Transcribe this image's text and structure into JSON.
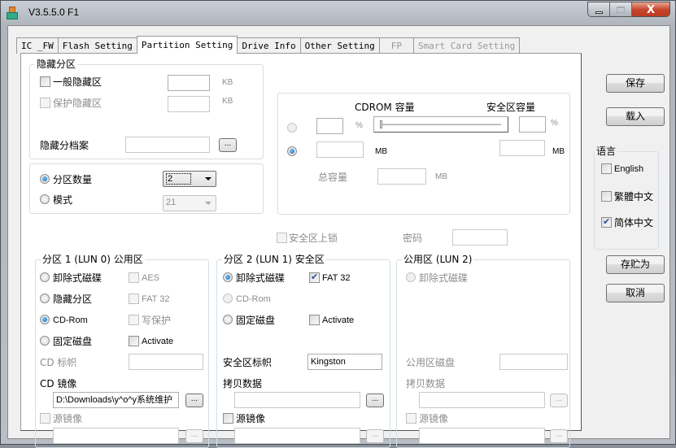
{
  "window": {
    "title": "V3.5.5.0 F1",
    "controls": {
      "minimize": "minimize",
      "maximize": "maximize",
      "close": "X"
    }
  },
  "tabs": [
    {
      "label": "IC _FW",
      "state": "normal"
    },
    {
      "label": "Flash Setting",
      "state": "normal"
    },
    {
      "label": "Partition Setting",
      "state": "active"
    },
    {
      "label": "Drive Info",
      "state": "normal"
    },
    {
      "label": "Other Setting",
      "state": "normal"
    },
    {
      "label": "FP",
      "state": "disabled"
    },
    {
      "label": "Smart Card Setting",
      "state": "disabled"
    }
  ],
  "hidden_partition": {
    "legend": "隐藏分区",
    "general_hidden": {
      "label": "一般隐藏区",
      "checked": false,
      "value": "",
      "unit": "KB"
    },
    "protected_hidden": {
      "label": "保护隐藏区",
      "checked": false,
      "value": "",
      "unit": "KB"
    },
    "hidden_file": {
      "label": "隐藏分档案",
      "value": "",
      "browse": "..."
    }
  },
  "partition_mode": {
    "count": {
      "label": "分区数量",
      "selected": true,
      "value": "2"
    },
    "mode": {
      "label": "模式",
      "selected": false,
      "value": "21"
    }
  },
  "capacity": {
    "cdrom_label": "CDROM 容量",
    "secure_label": "安全区容量",
    "percent_unit": "%",
    "mb_unit": "MB",
    "percent_mode_selected": false,
    "mb_mode_selected": true,
    "cdrom_percent": "",
    "secure_percent": "",
    "cdrom_mb": "",
    "secure_mb": "",
    "slider_value_pct": 0,
    "total_label": "总容量",
    "total_value": "",
    "total_unit": "MB"
  },
  "lock": {
    "label": "安全区上锁",
    "checked": false,
    "password_label": "密码",
    "password_value": ""
  },
  "lun0": {
    "legend": "分区 1 (LUN 0) 公用区",
    "options": [
      {
        "label": "卸除式磁碟",
        "selected": false
      },
      {
        "label": "隐藏分区",
        "selected": false
      },
      {
        "label": "CD-Rom",
        "selected": true
      },
      {
        "label": "固定磁盘",
        "selected": false
      }
    ],
    "checks": [
      {
        "label": "AES",
        "checked": false,
        "enabled": false
      },
      {
        "label": "FAT 32",
        "checked": false,
        "enabled": false
      },
      {
        "label": "写保护",
        "checked": false,
        "enabled": false
      },
      {
        "label": "Activate",
        "checked": false,
        "enabled": true
      }
    ],
    "cd_label": {
      "label": "CD 标帜",
      "value": ""
    },
    "cd_image": {
      "label": "CD 镜像",
      "value": "D:\\Downloads\\y^o^y系统维护",
      "browse": "..."
    },
    "source_image": {
      "label": "源镜像",
      "checked": false,
      "value": "",
      "browse": "..."
    }
  },
  "lun1": {
    "legend": "分区 2 (LUN 1) 安全区",
    "options": [
      {
        "label": "卸除式磁碟",
        "selected": true
      },
      {
        "label": "CD-Rom",
        "selected": false
      },
      {
        "label": "固定磁盘",
        "selected": false
      }
    ],
    "checks": [
      {
        "label": "FAT 32",
        "checked": true
      },
      {
        "label": "Activate",
        "checked": false
      }
    ],
    "secure_label": {
      "label": "安全区标帜",
      "value": "Kingston"
    },
    "copy_data": {
      "label": "拷贝数据",
      "value": "",
      "browse": "..."
    },
    "source_image": {
      "label": "源镜像",
      "checked": false,
      "value": "",
      "browse": "..."
    }
  },
  "lun2": {
    "legend": "公用区 (LUN 2)",
    "options": [
      {
        "label": "卸除式磁碟",
        "selected": false
      }
    ],
    "public_disk": {
      "label": "公用区磁盘",
      "value": ""
    },
    "copy_data": {
      "label": "拷贝数据",
      "value": "",
      "browse": "..."
    },
    "source_image": {
      "label": "源镜像",
      "checked": false,
      "value": "",
      "browse": "..."
    }
  },
  "side": {
    "save": "保存",
    "load": "载入",
    "language_legend": "语言",
    "languages": [
      {
        "label": "English",
        "checked": false
      },
      {
        "label": "繁體中文",
        "checked": false
      },
      {
        "label": "简体中文",
        "checked": true
      }
    ],
    "save_as": "存贮为",
    "cancel": "取消"
  }
}
